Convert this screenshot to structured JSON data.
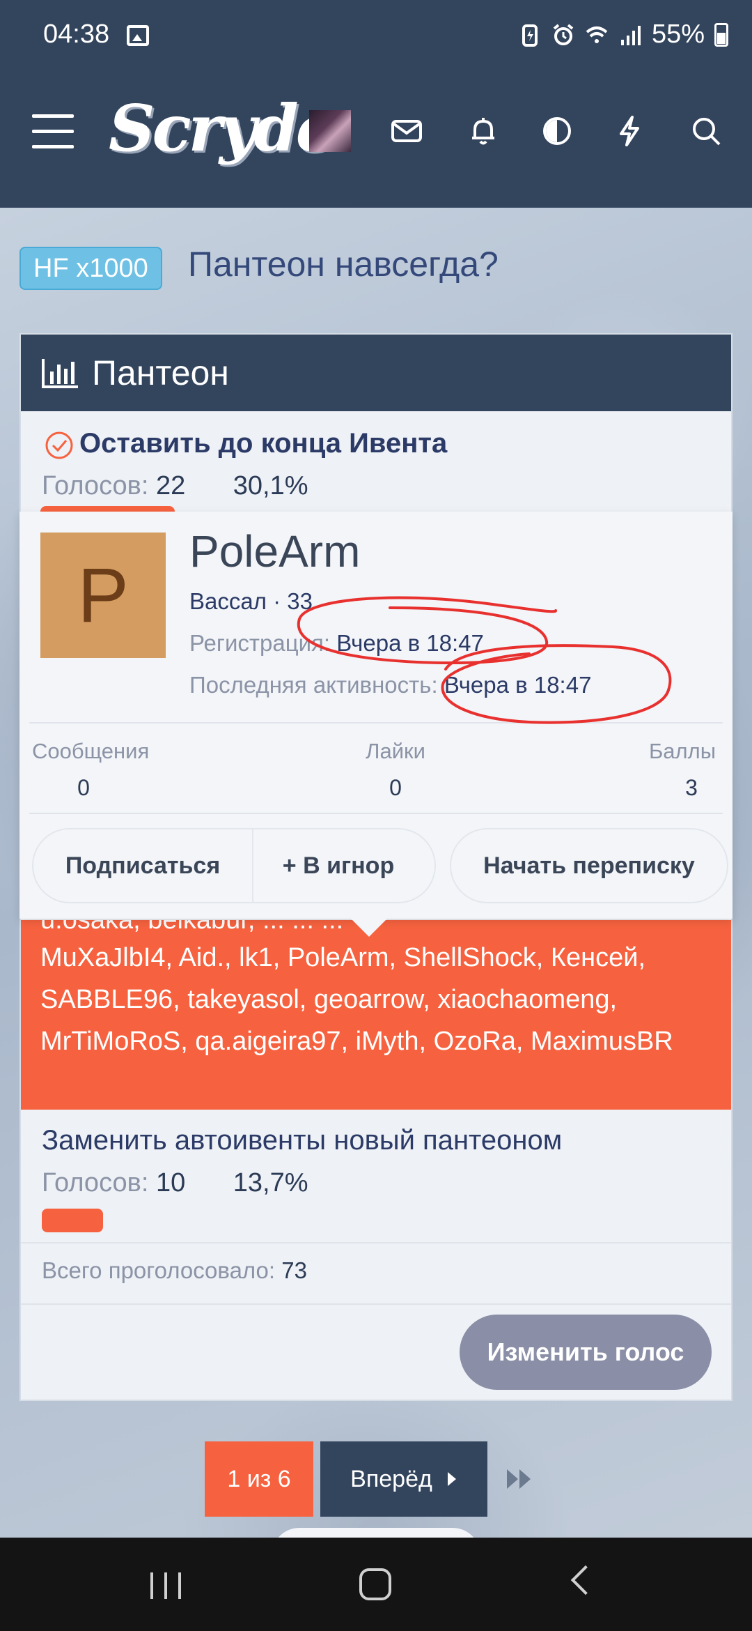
{
  "status_bar": {
    "time": "04:38",
    "battery": "55%"
  },
  "header": {
    "logo": "Scryde",
    "icons": [
      "menu-icon",
      "avatar",
      "mail-icon",
      "bell-icon",
      "contrast-icon",
      "lightning-icon",
      "search-icon"
    ]
  },
  "thread": {
    "prefix": "HF x1000",
    "title": "Пантеон навсегда?"
  },
  "poll": {
    "title": "Пантеон",
    "votes_label": "Голосов:",
    "options": [
      {
        "label": "Оставить до конца Ивента",
        "votes": "22",
        "percent": "30,1%",
        "fraction": 0.301,
        "selected": true
      },
      {
        "voters_cut": "u.osaka, belkabur, ... ... ...",
        "voters": "MuXaJlbI4, Aid., lk1, PoleArm, ShellShock, Кенсей, SABBLE96, takeyasol, geoarrow, xiaochaomeng, MrTiMoRoS, qa.aigeira97, iMyth, OzoRa, MaximusBR"
      },
      {
        "label": "Заменить автоивенты новый пантеоном",
        "votes": "10",
        "percent": "13,7%",
        "fraction": 0.137
      }
    ],
    "total_label": "Всего проголосовало:",
    "total_value": "73",
    "change_vote_button": "Изменить голос"
  },
  "member_card": {
    "avatar_letter": "P",
    "name": "PoleArm",
    "title": "Вассал · 33",
    "registration_label": "Регистрация:",
    "registration_value": "Вчера в 18:47",
    "last_activity_label": "Последняя активность:",
    "last_activity_value": "Вчера в 18:47",
    "stats": [
      {
        "label": "Сообщения",
        "value": "0"
      },
      {
        "label": "Лайки",
        "value": "0"
      },
      {
        "label": "Баллы",
        "value": "3"
      }
    ],
    "buttons": {
      "follow": "Подписаться",
      "ignore": "+ В игнор",
      "message": "Начать переписку"
    },
    "annotation_color": "#e8312f"
  },
  "pagination": {
    "current": "1 из 6",
    "next": "Вперёд"
  },
  "colors": {
    "header_bg": "#33445d",
    "accent": "#f6623f",
    "prefix_badge": "#6ec1e4"
  }
}
